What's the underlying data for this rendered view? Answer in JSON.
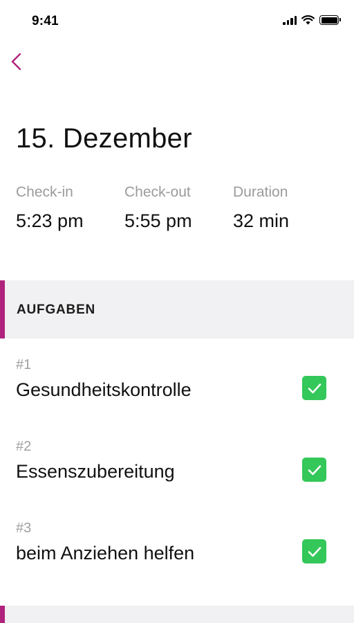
{
  "status_bar": {
    "time": "9:41",
    "icons": [
      "signal-icon",
      "wifi-icon",
      "battery-icon"
    ]
  },
  "nav": {
    "back_icon": "chevron-left-icon"
  },
  "page": {
    "title": "15. Dezember"
  },
  "stats": [
    {
      "label": "Check-in",
      "value": "5:23 pm"
    },
    {
      "label": "Check-out",
      "value": "5:55 pm"
    },
    {
      "label": "Duration",
      "value": "32 min"
    }
  ],
  "tasks_section": {
    "title": "AUFGABEN",
    "items": [
      {
        "number": "#1",
        "title": "Gesundheitskontrolle",
        "checked": true
      },
      {
        "number": "#2",
        "title": "Essenszubereitung",
        "checked": true
      },
      {
        "number": "#3",
        "title": "beim Anziehen helfen",
        "checked": true
      }
    ]
  },
  "colors": {
    "accent": "#b0237c",
    "check": "#34c759",
    "section_bg": "#f1f1f3",
    "label_gray": "#9b9b9b"
  }
}
